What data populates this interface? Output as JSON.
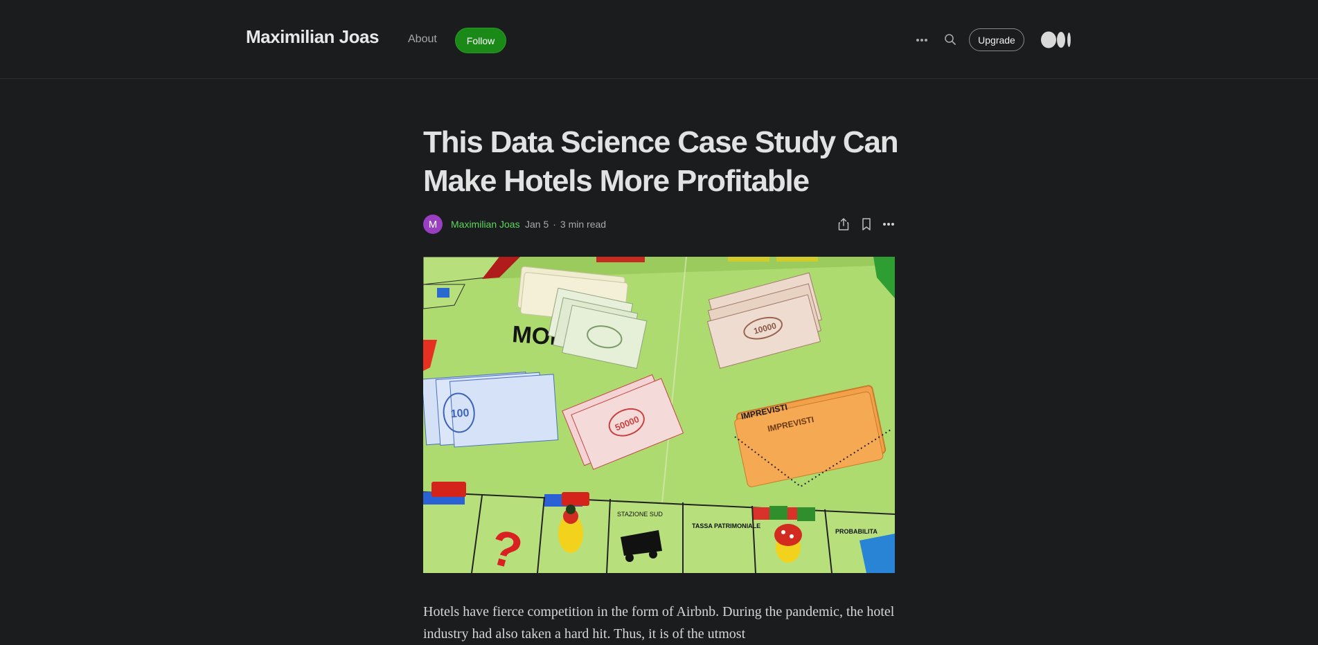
{
  "header": {
    "brand": "Maximilian Joas",
    "about_label": "About",
    "follow_label": "Follow",
    "upgrade_label": "Upgrade",
    "icons": [
      "more-icon",
      "search-icon",
      "medium-logo-icon"
    ]
  },
  "article": {
    "title": "This Data Science Case Study Can Make Hotels More Profitable",
    "author_initial": "M",
    "author_name": "Maximilian Joas",
    "date": "Jan 5",
    "separator": "·",
    "read_time": "3 min read",
    "action_icons": [
      "share-icon",
      "bookmark-icon",
      "more-icon"
    ],
    "hero_image": {
      "board_words": [
        "MONOPOLI",
        "IMPREVISTI",
        "STAZIONE SUD",
        "TASSA PATRIMONIALE",
        "PROBABILITA"
      ],
      "banknote_values": [
        "100",
        "50000",
        "10000"
      ]
    },
    "body_paragraph": "Hotels have fierce competition in the form of Airbnb. During the pandemic, the hotel industry had also taken a hard hit. Thus, it is of the utmost"
  },
  "colors": {
    "background": "#1b1c1e",
    "follow_green": "#1a8917",
    "author_green": "#5cd85a",
    "avatar_purple": "#9b3fc2",
    "board_green": "#a9d86a"
  }
}
